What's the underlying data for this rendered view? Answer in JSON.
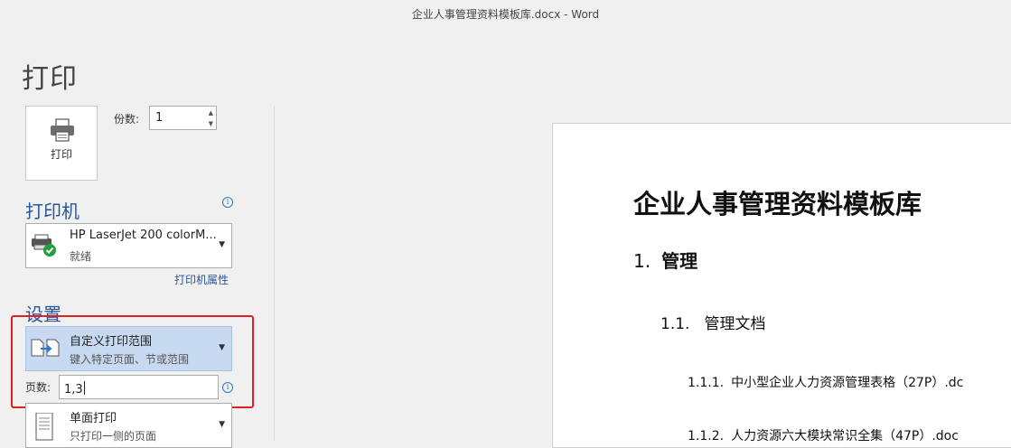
{
  "window": {
    "title": "企业人事管理资料模板库.docx - Word"
  },
  "page_title": "打印",
  "print_button": {
    "label": "打印",
    "icon": "printer-icon"
  },
  "copies": {
    "label": "份数:",
    "value": "1"
  },
  "printer": {
    "heading": "打印机",
    "name": "HP LaserJet 200 colorM...",
    "status": "就绪",
    "properties_link": "打印机属性"
  },
  "settings": {
    "heading": "设置",
    "range": {
      "main": "自定义打印范围",
      "sub": "键入特定页面、节或范围"
    },
    "pages": {
      "label": "页数:",
      "value": "1,3"
    },
    "sides": {
      "main": "单面打印",
      "sub": "只打印一侧的页面"
    }
  },
  "preview": {
    "title": "企业人事管理资料模板库",
    "h1": {
      "num": "1.",
      "text": "管理"
    },
    "h2": {
      "num": "1.1.",
      "text": "管理文档"
    },
    "items": [
      {
        "num": "1.1.1.",
        "text": "中小型企业人力资源管理表格（27P）.dc"
      },
      {
        "num": "1.1.2.",
        "text": "人力资源六大模块常识全集（47P）.doc"
      }
    ]
  },
  "colors": {
    "accent": "#2b579a",
    "highlight": "#e02020",
    "selected": "#c7daf1"
  }
}
